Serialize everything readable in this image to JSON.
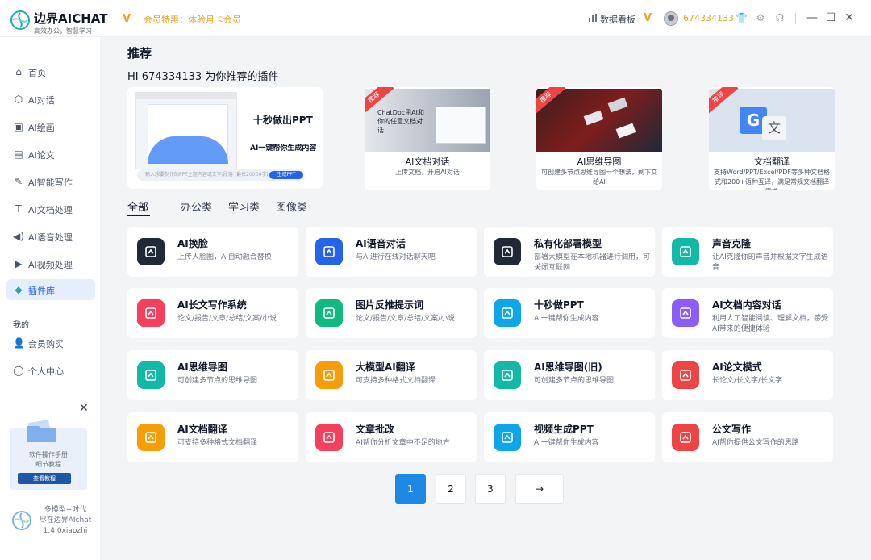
{
  "app": {
    "name": "边界AICHAT",
    "tagline": "高效办公，智慧学习",
    "member_promo": "会员特惠：体验月卡会员",
    "dashboard_label": "数据看板",
    "user_id": "674334133",
    "brand_color": "#2aa7b6",
    "accent_color": "#2563eb",
    "gold_color": "#e5a823"
  },
  "sidebar": {
    "items": [
      {
        "label": "首页",
        "icon": "home-icon"
      },
      {
        "label": "AI对话",
        "icon": "cube-icon"
      },
      {
        "label": "AI绘画",
        "icon": "image-icon"
      },
      {
        "label": "AI论文",
        "icon": "document-icon"
      },
      {
        "label": "AI智能写作",
        "icon": "pen-icon"
      },
      {
        "label": "AI文档处理",
        "icon": "text-doc-icon"
      },
      {
        "label": "AI语音处理",
        "icon": "speaker-icon"
      },
      {
        "label": "AI视频处理",
        "icon": "play-icon"
      },
      {
        "label": "插件库",
        "icon": "diamond-icon",
        "active": true
      }
    ],
    "section_label": "我的",
    "my_items": [
      {
        "label": "会员购买",
        "icon": "user-icon"
      },
      {
        "label": "个人中心",
        "icon": "person-outline-icon"
      }
    ],
    "promo": {
      "text_line1": "软件操作手册",
      "text_line2": "细节教程",
      "button": "查看教程"
    },
    "footer": {
      "line1": "多模型+时代",
      "line2": "尽在边界AIchat",
      "version": "1.4.0xiaozhi"
    }
  },
  "main": {
    "title": "推荐",
    "greeting": "HI 674334133 为你推荐的插件",
    "hero": {
      "title": "十秒做出PPT",
      "subtitle": "AI一键帮你生成内容",
      "input_placeholder": "输入想要制作的PPT主题内容或文字/段落 (最长20000字)",
      "cta": "生成PPT"
    },
    "featured": [
      {
        "ribbon": "推荐",
        "title": "AI文档对话",
        "desc": "上传文档，开启AI对话",
        "image_text": "ChatDoc用AI和你的任意文档对话"
      },
      {
        "ribbon": "推荐",
        "title": "AI思维导图",
        "desc": "可创建多节点思维导图一个想法，剩下交给AI"
      },
      {
        "ribbon": "推荐",
        "title": "文档翻译",
        "desc": "支持Word/PPT/Excel/PDF等多种文档格式和200+语种互译，满足常规文档翻译需求"
      }
    ],
    "tabs": [
      "全部",
      "办公类",
      "学习类",
      "图像类"
    ],
    "plugins": [
      {
        "title": "AI换脸",
        "desc": "上传人脸图，AI自动融合替换",
        "icon": "face-swap-icon",
        "color": "#1f2937"
      },
      {
        "title": "AI语音对话",
        "desc": "与AI进行在线对话聊天吧",
        "icon": "voice-chat-icon",
        "color": "#2563eb"
      },
      {
        "title": "私有化部署模型",
        "desc": "部署大模型在本地机器进行调用，可关闭互联网",
        "icon": "cloud-icon",
        "color": "#1f2937"
      },
      {
        "title": "声音克隆",
        "desc": "让AI克隆你的声音并根据文字生成语音",
        "icon": "sound-wave-icon",
        "color": "#14b8a6"
      },
      {
        "title": "AI长文写作系统",
        "desc": "论文/报告/文章/总结/文案/小说",
        "icon": "edit-icon",
        "color": "#f43f5e"
      },
      {
        "title": "图片反推提示词",
        "desc": "论文/报告/文章/总结/文案/小说",
        "icon": "image-prompt-icon",
        "color": "#10b981"
      },
      {
        "title": "十秒做PPT",
        "desc": "AI一键帮你生成内容",
        "icon": "ppt-icon",
        "color": "#0ea5e9"
      },
      {
        "title": "AI文档内容对话",
        "desc": "利用人工智能阅读、理解文档，感受AI带来的便捷体验",
        "icon": "word-doc-icon",
        "color": "#8b5cf6"
      },
      {
        "title": "AI思维导图",
        "desc": "可创建多节点的思维导图",
        "icon": "brain-icon",
        "color": "#14b8a6"
      },
      {
        "title": "大模型AI翻译",
        "desc": "可支持多种格式文档翻译",
        "icon": "translate-doc-icon",
        "color": "#f59e0b"
      },
      {
        "title": "AI思维导图(旧)",
        "desc": "可创建多节点的思维导图",
        "icon": "brain-icon",
        "color": "#14b8a6"
      },
      {
        "title": "AI论文模式",
        "desc": "长论文/长文字/长文字",
        "icon": "brush-icon",
        "color": "#ef4444"
      },
      {
        "title": "AI文档翻译",
        "desc": "可支持多种格式文档翻译",
        "icon": "doc-translate-icon",
        "color": "#f59e0b"
      },
      {
        "title": "文章批改",
        "desc": "AI帮你分析文章中不足的地方",
        "icon": "correct-icon",
        "color": "#f43f5e"
      },
      {
        "title": "视频生成PPT",
        "desc": "AI一键帮你生成内容",
        "icon": "video-ppt-icon",
        "color": "#0ea5e9"
      },
      {
        "title": "公文写作",
        "desc": "AI帮你提供公文写作的思路",
        "icon": "official-doc-icon",
        "color": "#ef4444"
      }
    ],
    "pagination": {
      "pages": [
        "1",
        "2",
        "3"
      ],
      "current": "1",
      "next": "→"
    }
  }
}
